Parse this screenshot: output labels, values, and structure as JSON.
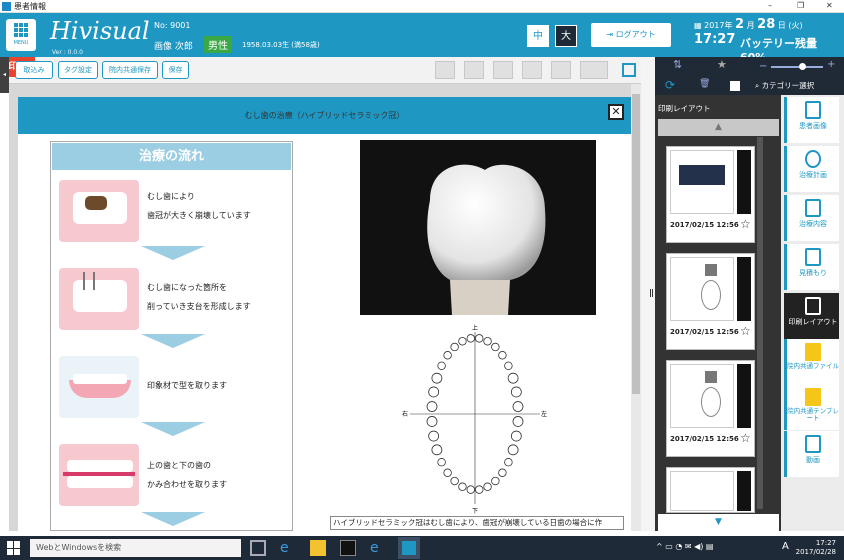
{
  "window": {
    "title": "患者情報",
    "controls": [
      "–",
      "❐",
      "✕"
    ]
  },
  "header": {
    "menu_label": "MENU",
    "logo": "Hivisual",
    "version": "Ver : 0.0.0",
    "patient": {
      "no": "No: 9001",
      "name": "画像 次郎",
      "sex": "男性",
      "birth": "1958.03.03生 (満58歳)"
    },
    "size_buttons": [
      "中",
      "大"
    ],
    "logout_label": "ログアウト",
    "date_year": "2017年",
    "date_month": "2",
    "date_month_unit": "月",
    "date_day": "28",
    "date_day_unit": "日",
    "date_dow": "(火)",
    "time": "17:27",
    "battery": "バッテリー残量  60%"
  },
  "toolbar": {
    "buttons": [
      "取込み",
      "タグ設定",
      "院内共通保存",
      "保存"
    ],
    "print_label": "印刷"
  },
  "document": {
    "title": "むし歯の治療（ハイブリッドセラミック冠）",
    "close": "✕",
    "flow_title": "治療の流れ",
    "steps": [
      {
        "line1": "むし歯により",
        "line2": "歯冠が大きく崩壊しています"
      },
      {
        "line1": "むし歯になった箇所を",
        "line2": "削っていき支台を形成します"
      },
      {
        "line1": "印象材で型を取ります",
        "line2": ""
      },
      {
        "line1": "上の歯と下の歯の",
        "line2": "かみ合わせを取ります"
      }
    ],
    "caption": "ハイブリッドセラミック冠はむし歯により、歯冠が崩壊している日歯の場合に作",
    "chart_labels": {
      "top": "上",
      "bottom": "下",
      "left": "右",
      "right": "左"
    }
  },
  "right_panel": {
    "category_label": "カテゴリー選択",
    "layout_label": "印刷レイアウト",
    "thumbs": [
      {
        "date": "2017/02/15 12:56"
      },
      {
        "date": "2017/02/15 12:56"
      },
      {
        "date": "2017/02/15 12:56"
      },
      {
        "date": ""
      }
    ],
    "up": "▲",
    "down": "▼"
  },
  "sidebar": [
    {
      "label": "患者画像"
    },
    {
      "label": "治療計画"
    },
    {
      "label": "治療内容"
    },
    {
      "label": "見積もり"
    },
    {
      "label": "印刷レイアウト"
    },
    {
      "label": "院内共通ファイル"
    },
    {
      "label": "院内共通テンプレート"
    },
    {
      "label": "動画"
    }
  ],
  "taskbar": {
    "search_placeholder": "WebとWindowsを検索",
    "time": "17:27",
    "date": "2017/02/28",
    "ime": "A"
  }
}
